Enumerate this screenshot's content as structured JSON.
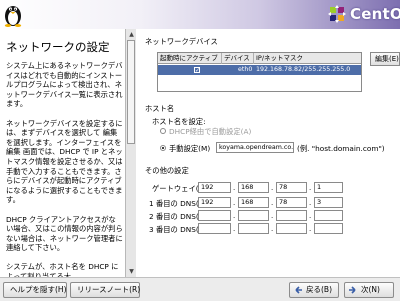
{
  "app": {
    "brand": "CentOS"
  },
  "help": {
    "title": "ネットワークの設定",
    "paragraphs": [
      "システム上にあるネットワークデバイスはどれでも自動的にインストールプログラムによって検出され、ネットワークデバイス一覧に表示されます。",
      "ネットワークデバイスを設定するには、まずデバイスを選択して 編集 を選択します。インターフェイスを編集 画面では、DHCP で IP とネットマスク情報を設定させるか、又は手動で入力することもできます。さらにデバイスが起動時にアクティブになるように選択することもできます。",
      "DHCP クライアントアクセスがない場合、又はこの情報の内容が判らない場合は、ネットワーク管理者に連絡して下さい。",
      "システムが、ホスト名を DHCP によって割り当てる大"
    ]
  },
  "devices": {
    "section_label": "ネットワークデバイス",
    "columns": [
      "起動時にアクティブ",
      "デバイス",
      "IP/ネットマスク"
    ],
    "rows": [
      {
        "active": true,
        "device": "eth0",
        "ip_mask": "192.168.78.82/255.255.255.0"
      }
    ],
    "edit_button": "編集(E)"
  },
  "hostname": {
    "section_label": "ホスト名",
    "setting_label": "ホスト名を設定:",
    "dhcp_option": "DHCP経由で自動設定(A)",
    "manual_option": "手動設定(M)",
    "manual_value": "koyama.opendream.co.jp",
    "example": "(例. \"host.domain.com\")",
    "selected": "manual"
  },
  "other": {
    "section_label": "その他の設定",
    "gateway_label": "ゲートウェイ(G):",
    "gateway": [
      "192",
      "168",
      "78",
      "1"
    ],
    "dns1_label": "1 番目の DNS(P):",
    "dns1": [
      "192",
      "168",
      "78",
      "3"
    ],
    "dns2_label": "2 番目の DNS(S):",
    "dns2": [
      "",
      "",
      "",
      ""
    ],
    "dns3_label": "3 番目の DNS(T):",
    "dns3": [
      "",
      "",
      "",
      ""
    ]
  },
  "footer": {
    "hide_help": "ヘルプを隠す(H)",
    "release_notes": "リリースノート(R)",
    "back": "戻る(B)",
    "next": "次(N)"
  },
  "colors": {
    "selection": "#4d6da8",
    "banner_end": "#7d6fb0"
  }
}
